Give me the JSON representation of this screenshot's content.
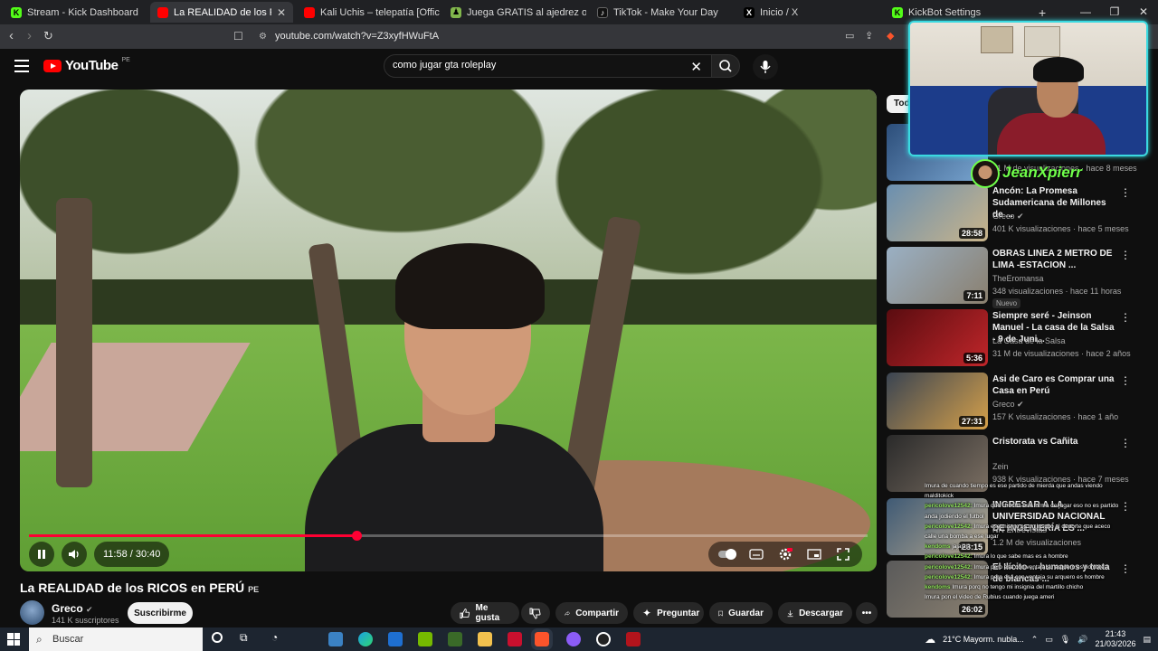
{
  "browser": {
    "tabs": [
      {
        "title": "Stream - Kick Dashboard",
        "icon": "kick-icon",
        "color": "#53fc18"
      },
      {
        "title": "La REALIDAD de los RICOS e",
        "icon": "youtube-icon",
        "color": "#ff0000",
        "active": true
      },
      {
        "title": "Kali Uchis – telepatía [Official Audio]",
        "icon": "youtube-icon",
        "color": "#ff0000"
      },
      {
        "title": "Juega GRATIS al ajedrez online - Aje",
        "icon": "chess-icon",
        "color": "#81b64c"
      },
      {
        "title": "TikTok - Make Your Day",
        "icon": "tiktok-icon",
        "color": "#ffffff"
      },
      {
        "title": "Inicio / X",
        "icon": "x-icon",
        "color": "#ffffff"
      },
      {
        "title": "KickBot Settings",
        "icon": "kickbot-icon",
        "color": "#53fc18"
      }
    ],
    "new_tab": "+",
    "url": "youtube.com/watch?v=Z3xyfHWuFtA"
  },
  "youtube": {
    "logo_text": "YouTube",
    "country": "PE",
    "search_query": "como jugar gta roleplay",
    "player": {
      "time": "11:58 / 30:40",
      "progress_fraction": 0.39
    },
    "video": {
      "title": "La REALIDAD de los RICOS en PERÚ",
      "title_cc": "PE",
      "channel": "Greco",
      "subscribers": "141 K suscriptores",
      "subscribe_label": "Suscribirme",
      "actions": {
        "like": "Me gusta",
        "share": "Compartir",
        "ask": "Preguntar",
        "save": "Guardar",
        "download": "Descargar"
      }
    },
    "sidebar": {
      "chip": "Tod",
      "first_meta": "31 M de visualizaciones · hace 8 meses",
      "recommendations": [
        {
          "title": "Ancón: La Promesa Sudamericana de Millones de ...",
          "channel": "Greco",
          "verified": true,
          "meta": "401 K visualizaciones · hace 5 meses",
          "duration": "28:58",
          "thumb": [
            "#6a8fb0",
            "#c9b48a"
          ]
        },
        {
          "title": "OBRAS LINEA 2 METRO DE LIMA -ESTACION ...",
          "channel": "TheEromansa",
          "verified": false,
          "meta": "348 visualizaciones · hace 11 horas",
          "badge": "Nuevo",
          "duration": "7:11",
          "thumb": [
            "#9ab0c4",
            "#8a7f6e"
          ]
        },
        {
          "title": "Siempre seré - Jeinson Manuel - La casa de la Salsa - 9 de Juni...",
          "channel": "La Casa de la Salsa",
          "verified": false,
          "meta": "31 M de visualizaciones · hace 2 años",
          "duration": "5:36",
          "thumb": [
            "#5a0c10",
            "#c0262a"
          ]
        },
        {
          "title": "Asi de Caro es Comprar una Casa en Perú",
          "channel": "Greco",
          "verified": true,
          "meta": "157 K visualizaciones · hace 1 año",
          "duration": "27:31",
          "thumb": [
            "#3a4452",
            "#d5a04a"
          ]
        },
        {
          "title": "Cristorata vs Cañita",
          "channel": "Zein",
          "verified": false,
          "meta": "938 K visualizaciones · hace 7 meses",
          "duration": "",
          "thumb": [
            "#2a2a2a",
            "#7a6e62"
          ]
        },
        {
          "title": "INGRESAR A LA UNIVERSIDAD NACIONAL DE INGENIERÍA ES ...",
          "channel": "NN Entrevistas",
          "verified": false,
          "meta": "1.2 M de visualizaciones",
          "duration": "23:15",
          "thumb": [
            "#3f5a75",
            "#b8a98f"
          ]
        },
        {
          "title": "El Ilícito ... humanos y trata de blancas ...",
          "channel": "",
          "verified": false,
          "meta": "",
          "duration": "26:02",
          "thumb": [
            "#5a5a5a",
            "#8a8070"
          ]
        }
      ]
    }
  },
  "stream_overlay": {
    "streamer_name": "JeanXpierr",
    "chat": [
      {
        "user": "",
        "text": "Imura de cuando tiempo es ese partido de mierda que andas viendo"
      },
      {
        "user": "",
        "text": "malditokick"
      },
      {
        "user": "pericolove12542:",
        "text": "Imura que chucha esa forma de jugar eso no es partido"
      },
      {
        "user": "",
        "text": "anda jodiendo el futbol"
      },
      {
        "user": "pericolove12542:",
        "text": "Imura ese mismo es un insulto al deporte que aceco"
      },
      {
        "user": "",
        "text": "calle una bomba a ese lugar"
      },
      {
        "user": "kendoms",
        "text": "jajajaja"
      },
      {
        "user": "pericolove12542:",
        "text": "Imura lo que sabe mas es a hombre"
      },
      {
        "user": "pericolove12542:",
        "text": "Imura pero esa con ventaja su arquero es hombre"
      },
      {
        "user": "pericolove12542:",
        "text": "Imura pero esa con ventaja su arquero es hombre"
      },
      {
        "user": "kendoms",
        "text": "Imura porq no tengo mi insignia del martillo chicho"
      },
      {
        "user": "",
        "text": "Imura pon el video de Rubius cuando juega ameri"
      }
    ]
  },
  "taskbar": {
    "search_placeholder": "Buscar",
    "weather": "21°C  Mayorm. nubla...",
    "time": "21:43",
    "date": "21/03/2026"
  }
}
